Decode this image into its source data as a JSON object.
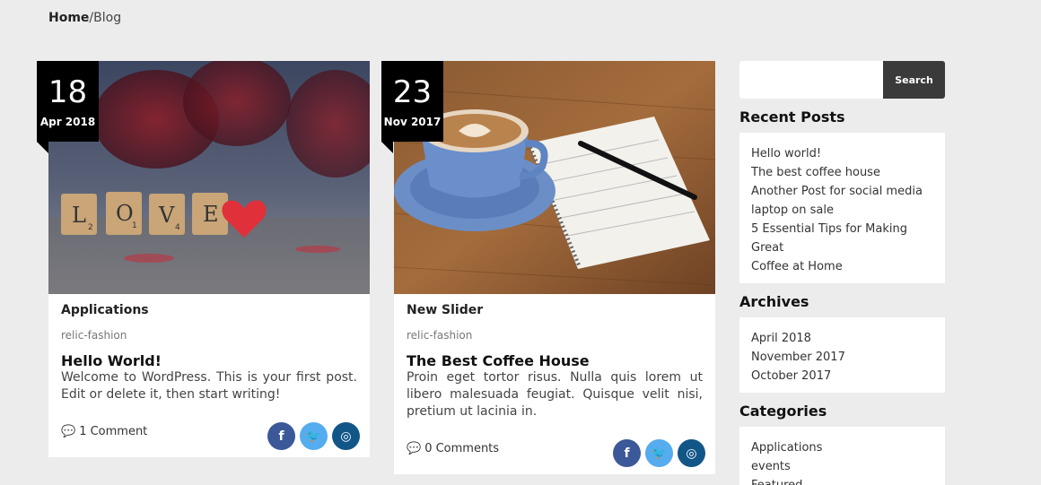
{
  "breadcrumb": {
    "home": "Home",
    "separator": "/",
    "current": "Blog"
  },
  "posts": [
    {
      "day": "18",
      "month": "Apr 2018",
      "category": "Applications",
      "author": "relic-fashion",
      "title": "Hello World!",
      "excerpt": "Welcome to WordPress. This is your first post. Edit or delete it, then start writing!",
      "comments": "1 Comment"
    },
    {
      "day": "23",
      "month": "Nov 2017",
      "category": "New Slider",
      "author": "relic-fashion",
      "title": "The Best Coffee House",
      "excerpt": "Proin eget tortor risus. Nulla quis lorem ut libero malesuada feugiat. Quisque velit nisi, pretium ut lacinia in.",
      "comments": "0 Comments"
    }
  ],
  "image_letters": [
    "L",
    "O",
    "V",
    "E"
  ],
  "image_letter_scores": [
    "2",
    "1",
    "4",
    ""
  ],
  "sidebar": {
    "search_button": "Search",
    "search_placeholder": "",
    "recent_posts_title": "Recent Posts",
    "recent_posts": [
      "Hello world!",
      "The best coffee house",
      "Another Post for social media",
      "laptop on sale",
      "5 Essential Tips for Making Great",
      "Coffee at Home"
    ],
    "archives_title": "Archives",
    "archives": [
      "April 2018",
      "November 2017",
      "October 2017"
    ],
    "categories_title": "Categories",
    "categories": [
      "Applications",
      "events",
      "Featured"
    ]
  },
  "social": {
    "facebook": "f",
    "twitter": "🐦",
    "instagram": "◎"
  },
  "colors": {
    "facebook": "#3b5998",
    "twitter": "#55acee",
    "instagram": "#125688",
    "date_badge": "#000000",
    "search_button": "#3a3a3a"
  }
}
